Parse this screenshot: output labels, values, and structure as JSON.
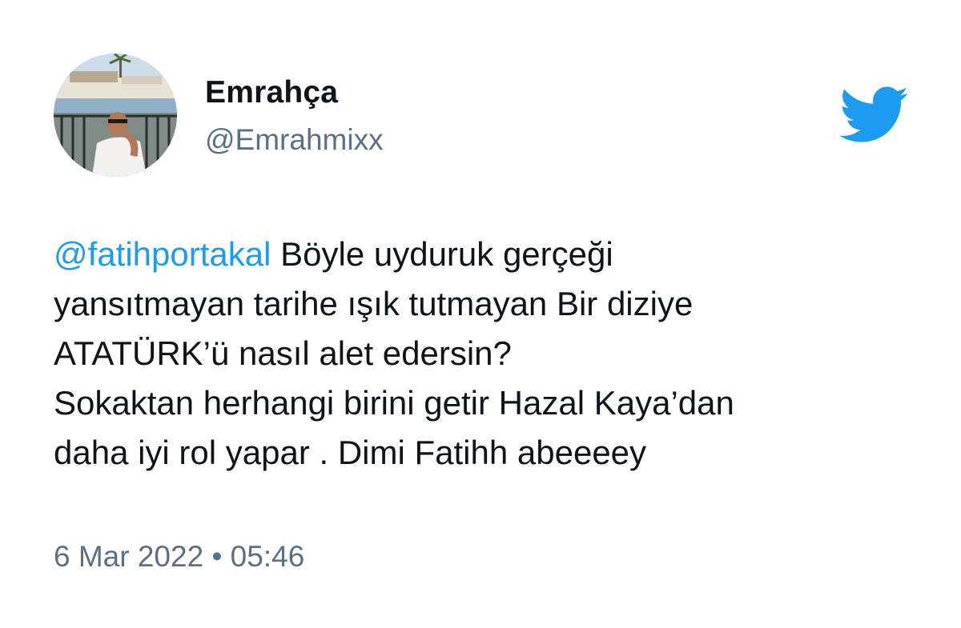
{
  "user": {
    "display_name": "Emrahça",
    "handle": "@Emrahmixx",
    "avatar": "profile-photo"
  },
  "brand": {
    "logo": "twitter-bird-icon",
    "color": "#1d9bf0"
  },
  "tweet": {
    "mention": "@fatihportakal",
    "line1_rest": " Böyle uyduruk gerçeği",
    "line2": "yansıtmayan tarihe ışık tutmayan Bir diziye",
    "line3": "ATATÜRK’ü nasıl alet edersin?",
    "line4": "Sokaktan herhangi birini getir Hazal Kaya’dan",
    "line5": "daha iyi rol yapar . Dimi Fatihh abeeeey"
  },
  "meta": {
    "timestamp": "6 Mar 2022 • 05:46"
  },
  "colors": {
    "mention": "#1d9bf0",
    "secondary_text": "#5b7083",
    "primary_text": "#0f1419"
  }
}
